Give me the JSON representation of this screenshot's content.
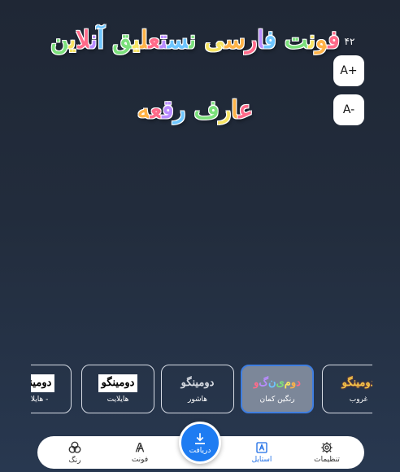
{
  "preview": {
    "line1": "فونت فارسی نستعلیق آنلاین",
    "line2": "عارف رقعه"
  },
  "font_size": {
    "value": "۴۲",
    "increase_label": "A+",
    "decrease_label": "A-"
  },
  "styles": {
    "sample_text": "دومینگو",
    "items": [
      {
        "name": "هایلایت - ",
        "kind": "highlight",
        "selected": false
      },
      {
        "name": "هایلایت",
        "kind": "highlight",
        "selected": false
      },
      {
        "name": "هاشور",
        "kind": "hatch",
        "selected": false
      },
      {
        "name": "رنگین کمان",
        "kind": "rainbow",
        "selected": true
      },
      {
        "name": "غروب",
        "kind": "sunset",
        "selected": false
      }
    ]
  },
  "nav": {
    "settings_label": "تنظیمات",
    "style_label": "استایل",
    "download_label": "دریافت",
    "font_label": "فونت",
    "color_label": "رنگ"
  },
  "colors": {
    "accent": "#1e7cf2",
    "background_top": "#1f2735",
    "background_bottom": "#283850",
    "rainbow": [
      "#ff6b8a",
      "#ffb347",
      "#f7e463",
      "#7be07b",
      "#6ec6ff",
      "#b98cff"
    ]
  },
  "icons": {
    "settings": "gear-icon",
    "style": "style-frame-icon",
    "download": "download-icon",
    "font": "font-a-icon",
    "color": "color-circles-icon"
  }
}
